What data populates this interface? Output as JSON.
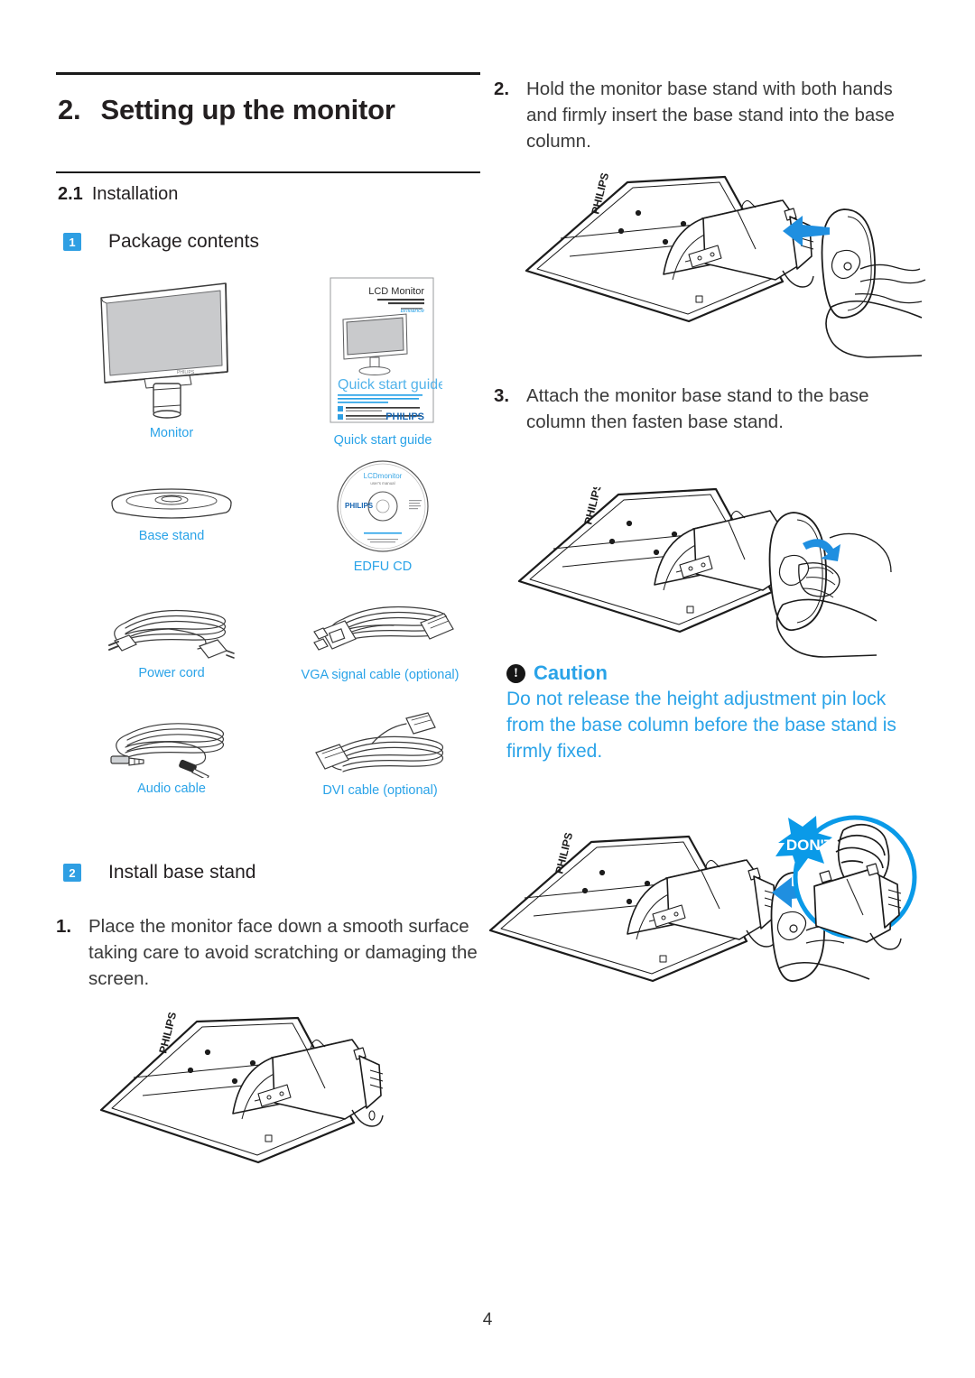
{
  "page": {
    "number": "4"
  },
  "chapter": {
    "number": "2.",
    "title": "Setting up the monitor"
  },
  "section": {
    "number": "2.1",
    "title": "Installation"
  },
  "steps_headings": [
    {
      "badge": "1",
      "label": "Package contents"
    },
    {
      "badge": "2",
      "label": "Install base stand"
    }
  ],
  "package_contents": [
    {
      "caption": "Monitor",
      "icon": "monitor-illustration"
    },
    {
      "caption": "Quick start guide",
      "icon": "quick-start-guide-illustration"
    },
    {
      "caption": "Base stand",
      "icon": "base-stand-illustration"
    },
    {
      "caption": "EDFU CD",
      "icon": "cd-disc-illustration"
    },
    {
      "caption": "Power cord",
      "icon": "power-cord-illustration"
    },
    {
      "caption": "VGA signal cable (optional)",
      "icon": "vga-cable-illustration"
    },
    {
      "caption": "Audio cable",
      "icon": "audio-cable-illustration"
    },
    {
      "caption": "DVI cable (optional)",
      "icon": "dvi-cable-illustration"
    }
  ],
  "quick_start_guide_cover": {
    "product_line": "LCD Monitor",
    "title": "Quick start guide",
    "brand": "PHILIPS",
    "sub_brand": "Brilliance"
  },
  "cd_label": {
    "line1": "LCD monitor",
    "line2": "user's manual",
    "brand": "PHILIPS"
  },
  "instructions": {
    "step1": {
      "marker": "1.",
      "text": "Place the monitor face down a smooth surface taking care to avoid scratching or damaging the screen."
    },
    "step2": {
      "marker": "2.",
      "text": "Hold the monitor base stand with both hands and firmly insert the base stand into the base column."
    },
    "step3": {
      "marker": "3.",
      "text": "Attach the monitor base stand to the base column then fasten base stand."
    }
  },
  "caution": {
    "icon": "exclamation-icon",
    "glyph": "!",
    "title": "Caution",
    "text": "Do not release the height adjustment pin lock from the base column before the base stand is firmly fixed."
  },
  "callout": {
    "dont_label": "DON'T"
  },
  "brand_mark": "PHILIPS",
  "colors": {
    "accent_blue": "#2aa3e8",
    "badge_blue": "#2f9fe3",
    "callout_blue": "#0a9ae8",
    "text": "#231f20",
    "rule": "#1a1a1a"
  }
}
